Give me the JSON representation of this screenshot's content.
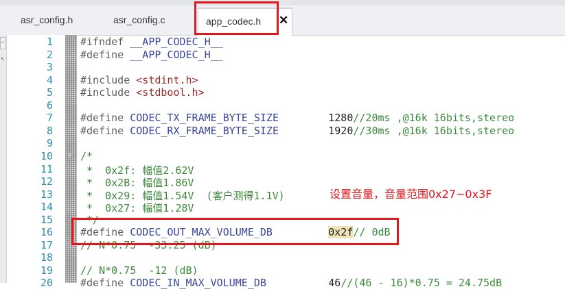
{
  "tabs": [
    {
      "label": "asr_config.h",
      "active": false
    },
    {
      "label": "asr_config.c",
      "active": false
    },
    {
      "label": "app_codec.h",
      "active": true
    }
  ],
  "close_glyph": "✕",
  "annotation": "设置音量，音量范围0x27~0x3F",
  "colors": {
    "highlight_box": "#e8141b",
    "line_number": "#2d8fb0",
    "comment": "#3a8a3a",
    "macro": "#3a4699"
  },
  "code_lines": [
    {
      "n": "1",
      "parts": [
        {
          "c": "pp",
          "t": "#ifndef "
        },
        {
          "c": "mac",
          "t": "__APP_CODEC_H__"
        }
      ]
    },
    {
      "n": "2",
      "parts": [
        {
          "c": "pp",
          "t": "#define "
        },
        {
          "c": "mac",
          "t": "__APP_CODEC_H__"
        }
      ]
    },
    {
      "n": "3",
      "parts": []
    },
    {
      "n": "4",
      "parts": [
        {
          "c": "pp",
          "t": "#include "
        },
        {
          "c": "str",
          "t": "<stdint.h>"
        }
      ]
    },
    {
      "n": "5",
      "parts": [
        {
          "c": "pp",
          "t": "#include "
        },
        {
          "c": "str",
          "t": "<stdbool.h>"
        }
      ]
    },
    {
      "n": "6",
      "parts": []
    },
    {
      "n": "7",
      "parts": [
        {
          "c": "pp",
          "t": "#define "
        },
        {
          "c": "mac",
          "t": "CODEC_TX_FRAME_BYTE_SIZE"
        },
        {
          "c": "num",
          "t": "        1280"
        },
        {
          "c": "cmt",
          "t": "//20ms ,@16k 16bits,stereo"
        }
      ]
    },
    {
      "n": "8",
      "parts": [
        {
          "c": "pp",
          "t": "#define "
        },
        {
          "c": "mac",
          "t": "CODEC_RX_FRAME_BYTE_SIZE"
        },
        {
          "c": "num",
          "t": "        1920"
        },
        {
          "c": "cmt",
          "t": "//30ms ,@16k 16bits,stereo"
        }
      ]
    },
    {
      "n": "9",
      "parts": []
    },
    {
      "n": "10",
      "parts": [
        {
          "c": "cmt",
          "t": "/*"
        }
      ]
    },
    {
      "n": "11",
      "parts": [
        {
          "c": "cmt",
          "t": " *  0x2f: 幅值2.62V"
        }
      ]
    },
    {
      "n": "12",
      "parts": [
        {
          "c": "cmt",
          "t": " *  0x2B: 幅值1.86V"
        }
      ]
    },
    {
      "n": "13",
      "parts": [
        {
          "c": "cmt",
          "t": " *  0x29: 幅值1.54V  (客户测得1.1V)"
        }
      ]
    },
    {
      "n": "14",
      "parts": [
        {
          "c": "cmt",
          "t": " *  0x27: 幅值1.28V"
        }
      ]
    },
    {
      "n": "15",
      "parts": [
        {
          "c": "cmt",
          "t": " */"
        }
      ]
    },
    {
      "n": "16",
      "parts": [
        {
          "c": "pp",
          "t": "#define "
        },
        {
          "c": "mac",
          "t": "CODEC_OUT_MAX_VOLUME_DB"
        },
        {
          "c": "num",
          "t": "         "
        },
        {
          "c": "hl",
          "t": "0x2f"
        },
        {
          "c": "cmt",
          "t": "// 0dB"
        }
      ]
    },
    {
      "n": "17",
      "parts": [
        {
          "c": "cmt",
          "t": "// N*0.75  -33.25 (dB)"
        }
      ]
    },
    {
      "n": "18",
      "parts": []
    },
    {
      "n": "19",
      "parts": [
        {
          "c": "cmt",
          "t": "// N*0.75  -12 (dB)"
        }
      ]
    },
    {
      "n": "20",
      "parts": [
        {
          "c": "pp",
          "t": "#define "
        },
        {
          "c": "mac",
          "t": "CODEC_IN_MAX_VOLUME_DB"
        },
        {
          "c": "num",
          "t": "          46"
        },
        {
          "c": "cmt",
          "t": "//(46 - 16)*0.75 = 24.75dB"
        }
      ]
    }
  ]
}
